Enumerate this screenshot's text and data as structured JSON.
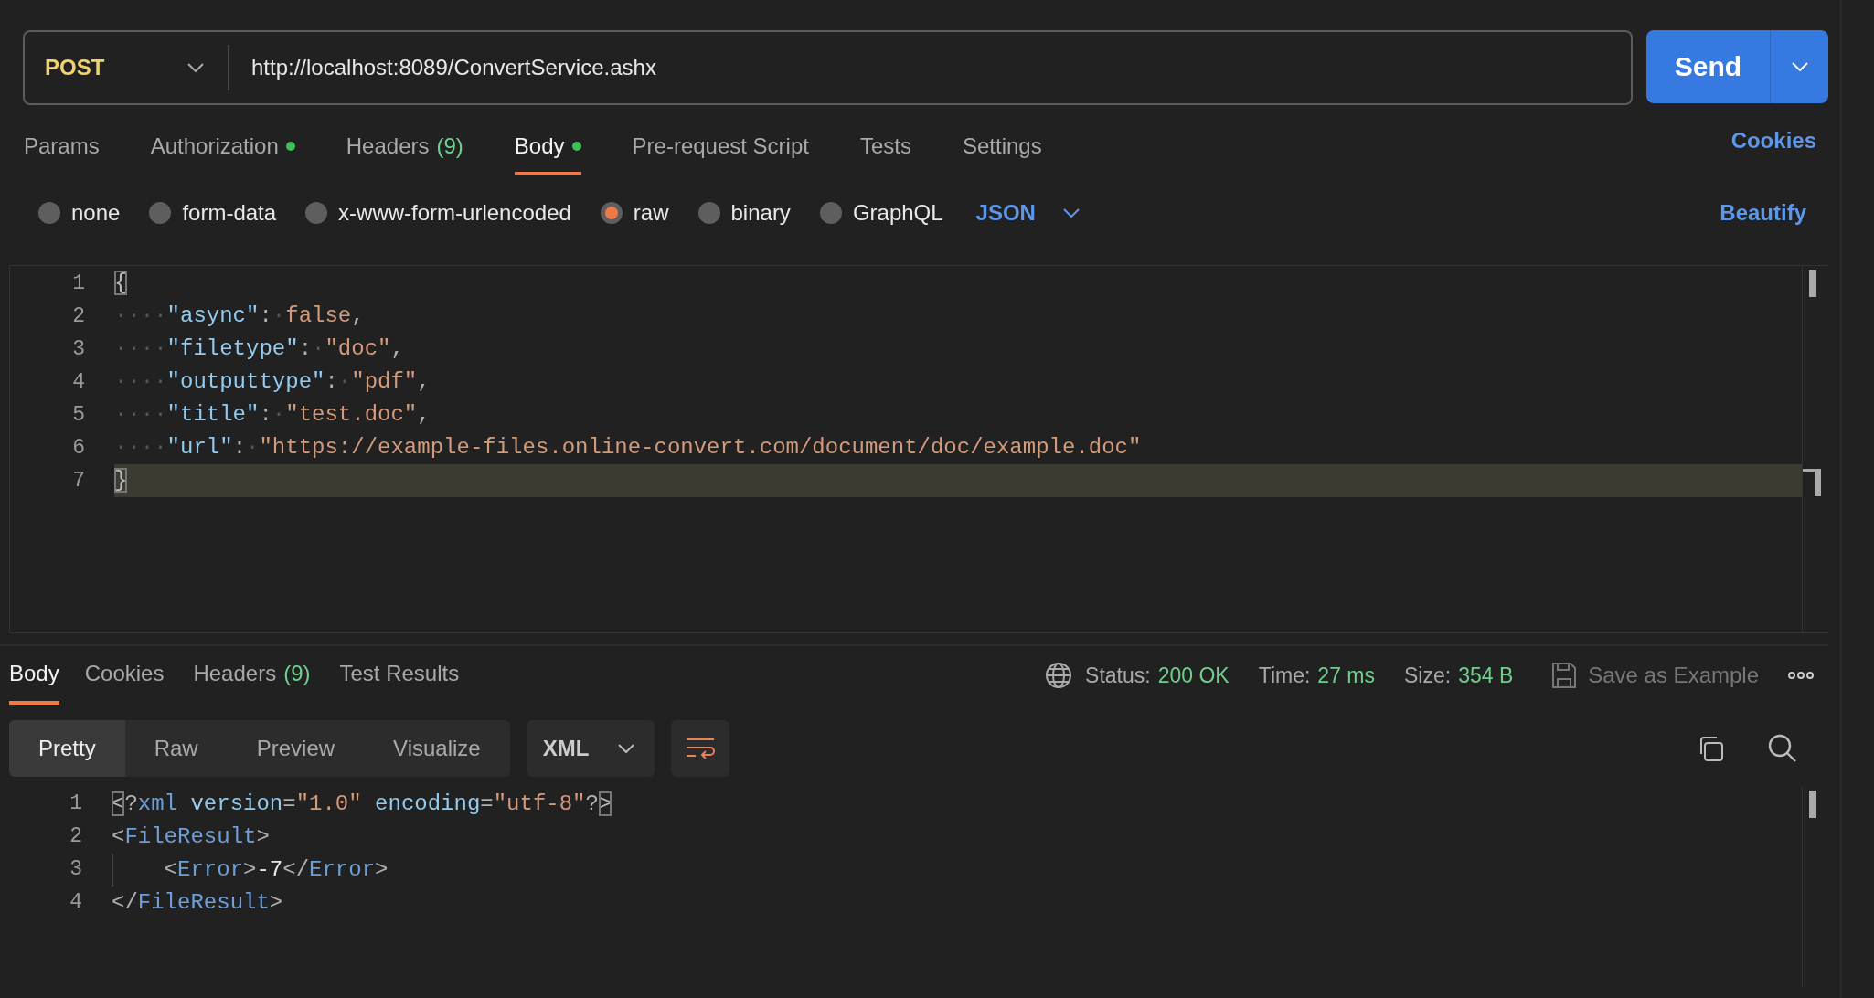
{
  "request": {
    "method": "POST",
    "url": "http://localhost:8089/ConvertService.ashx",
    "send_label": "Send"
  },
  "tabs": [
    {
      "label": "Params",
      "dot": false,
      "selected": false
    },
    {
      "label": "Authorization",
      "dot": true,
      "selected": false
    },
    {
      "label": "Headers",
      "count": "(9)",
      "dot": false,
      "selected": false
    },
    {
      "label": "Body",
      "dot": true,
      "selected": true
    },
    {
      "label": "Pre-request Script",
      "dot": false,
      "selected": false
    },
    {
      "label": "Tests",
      "dot": false,
      "selected": false
    },
    {
      "label": "Settings",
      "dot": false,
      "selected": false
    }
  ],
  "cookies_link": "Cookies",
  "body_types": [
    {
      "label": "none",
      "selected": false
    },
    {
      "label": "form-data",
      "selected": false
    },
    {
      "label": "x-www-form-urlencoded",
      "selected": false
    },
    {
      "label": "raw",
      "selected": true
    },
    {
      "label": "binary",
      "selected": false
    },
    {
      "label": "GraphQL",
      "selected": false
    }
  ],
  "language": "JSON",
  "beautify": "Beautify",
  "editor": {
    "lines": [
      {
        "number": "1",
        "current": false,
        "tokens": [
          {
            "kind": "bracket",
            "text": "{"
          }
        ]
      },
      {
        "number": "2",
        "current": false,
        "tokens": [
          {
            "kind": "ws",
            "text": "····"
          },
          {
            "kind": "key",
            "text": "\"async\""
          },
          {
            "kind": "punct",
            "text": ":"
          },
          {
            "kind": "ws",
            "text": "·"
          },
          {
            "kind": "value",
            "text": "false"
          },
          {
            "kind": "punct",
            "text": ","
          }
        ]
      },
      {
        "number": "3",
        "current": false,
        "tokens": [
          {
            "kind": "ws",
            "text": "····"
          },
          {
            "kind": "key",
            "text": "\"filetype\""
          },
          {
            "kind": "punct",
            "text": ":"
          },
          {
            "kind": "ws",
            "text": "·"
          },
          {
            "kind": "value",
            "text": "\"doc\""
          },
          {
            "kind": "punct",
            "text": ","
          }
        ]
      },
      {
        "number": "4",
        "current": false,
        "tokens": [
          {
            "kind": "ws",
            "text": "····"
          },
          {
            "kind": "key",
            "text": "\"outputtype\""
          },
          {
            "kind": "punct",
            "text": ":"
          },
          {
            "kind": "ws",
            "text": "·"
          },
          {
            "kind": "value",
            "text": "\"pdf\""
          },
          {
            "kind": "punct",
            "text": ","
          }
        ]
      },
      {
        "number": "5",
        "current": false,
        "tokens": [
          {
            "kind": "ws",
            "text": "····"
          },
          {
            "kind": "key",
            "text": "\"title\""
          },
          {
            "kind": "punct",
            "text": ":"
          },
          {
            "kind": "ws",
            "text": "·"
          },
          {
            "kind": "value",
            "text": "\"test.doc\""
          },
          {
            "kind": "punct",
            "text": ","
          }
        ]
      },
      {
        "number": "6",
        "current": false,
        "tokens": [
          {
            "kind": "ws",
            "text": "····"
          },
          {
            "kind": "key",
            "text": "\"url\""
          },
          {
            "kind": "punct",
            "text": ":"
          },
          {
            "kind": "ws",
            "text": "·"
          },
          {
            "kind": "value",
            "text": "\"https://example-files.online-convert.com/document/doc/example.doc\""
          }
        ]
      },
      {
        "number": "7",
        "current": true,
        "tokens": [
          {
            "kind": "bracket",
            "text": "}"
          }
        ]
      }
    ]
  },
  "response": {
    "tabs": [
      {
        "label": "Body",
        "selected": true
      },
      {
        "label": "Cookies",
        "selected": false
      },
      {
        "label": "Headers",
        "count": "(9)",
        "selected": false
      },
      {
        "label": "Test Results",
        "selected": false
      }
    ],
    "status_label": "Status:",
    "status": "200 OK",
    "time_label": "Time:",
    "time": "27 ms",
    "size_label": "Size:",
    "size": "354 B",
    "save_label": "Save as Example",
    "views": [
      {
        "label": "Pretty",
        "selected": true
      },
      {
        "label": "Raw",
        "selected": false
      },
      {
        "label": "Preview",
        "selected": false
      },
      {
        "label": "Visualize",
        "selected": false
      }
    ],
    "format": "XML",
    "lines": [
      {
        "number": "1",
        "indent_guide": false,
        "tokens": [
          {
            "kind": "bracket",
            "text": "<"
          },
          {
            "kind": "punct",
            "text": "?"
          },
          {
            "kind": "tag",
            "text": "xml"
          },
          {
            "kind": "attr",
            "text": " version"
          },
          {
            "kind": "punct",
            "text": "="
          },
          {
            "kind": "value",
            "text": "\"1.0\""
          },
          {
            "kind": "attr",
            "text": " encoding"
          },
          {
            "kind": "punct",
            "text": "="
          },
          {
            "kind": "value",
            "text": "\"utf-8\""
          },
          {
            "kind": "punct",
            "text": "?"
          },
          {
            "kind": "bracket",
            "text": ">"
          }
        ]
      },
      {
        "number": "2",
        "indent_guide": false,
        "tokens": [
          {
            "kind": "punct",
            "text": "<"
          },
          {
            "kind": "tag",
            "text": "FileResult"
          },
          {
            "kind": "punct",
            "text": ">"
          }
        ]
      },
      {
        "number": "3",
        "indent_guide": true,
        "tokens": [
          {
            "kind": "punct",
            "text": "<"
          },
          {
            "kind": "tag",
            "text": "Error"
          },
          {
            "kind": "punct",
            "text": ">"
          },
          {
            "kind": "text",
            "text": "-7"
          },
          {
            "kind": "punct",
            "text": "</"
          },
          {
            "kind": "tag",
            "text": "Error"
          },
          {
            "kind": "punct",
            "text": ">"
          }
        ]
      },
      {
        "number": "4",
        "indent_guide": false,
        "tokens": [
          {
            "kind": "punct",
            "text": "</"
          },
          {
            "kind": "tag",
            "text": "FileResult"
          },
          {
            "kind": "punct",
            "text": ">"
          }
        ]
      }
    ]
  }
}
